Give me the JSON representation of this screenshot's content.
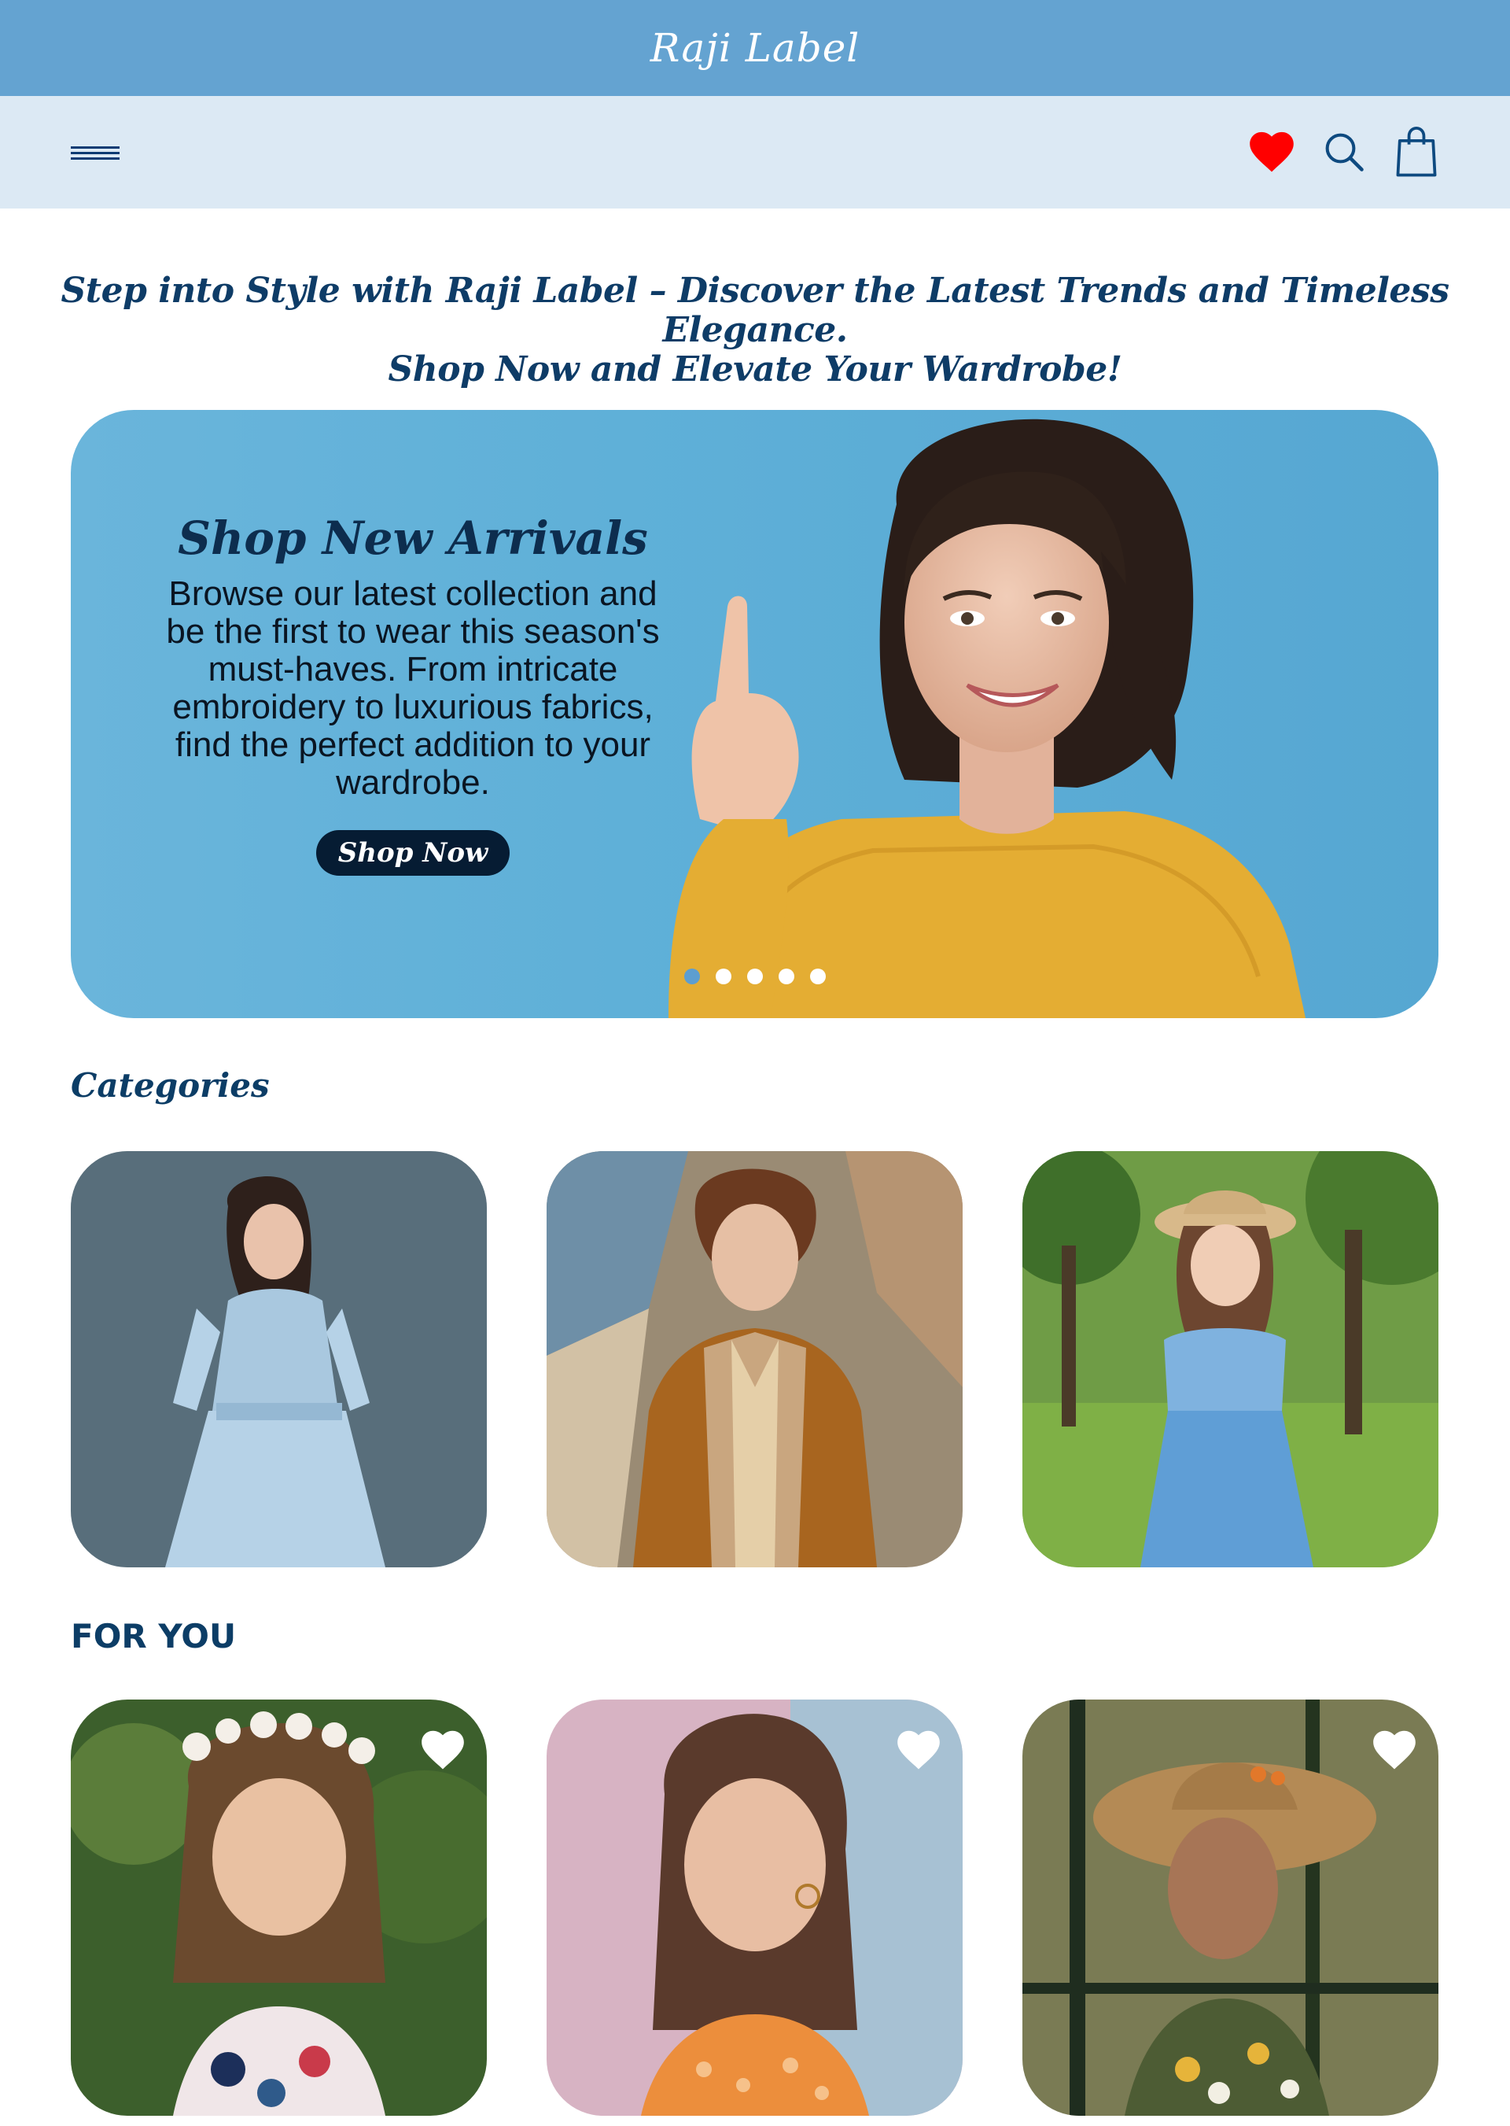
{
  "brand": {
    "logo_text": "Raji Label"
  },
  "nav": {
    "menu_icon": "hamburger-menu-icon",
    "wishlist_icon": "heart-icon",
    "search_icon": "search-icon",
    "cart_icon": "shopping-bag-icon",
    "wishlist_color": "#ff0000"
  },
  "tagline": {
    "line1": "Step into Style with Raji Label – Discover the Latest Trends and Timeless Elegance.",
    "line2": "Shop Now and Elevate Your Wardrobe!"
  },
  "hero": {
    "title": "Shop New Arrivals",
    "description": "Browse our latest collection and be the first to wear this season's must-haves. From intricate embroidery to luxurious fabrics, find the perfect addition to your wardrobe.",
    "button_label": "Shop Now",
    "slide_count": 5,
    "active_slide": 1
  },
  "categories": {
    "heading": "Categories",
    "items": [
      "women-category-image",
      "men-category-image",
      "kids-category-image"
    ]
  },
  "for_you": {
    "heading": "FOR YOU",
    "items": [
      "floral-dress-product-image",
      "orange-floral-top-product-image",
      "straw-hat-floral-top-product-image"
    ]
  },
  "colors": {
    "brand_bar": "#64a3d1",
    "nav_bar": "#dce9f4",
    "heading_text": "#0c3d66",
    "hero_bg": "#5fb0d8",
    "button_bg": "#061c33"
  }
}
